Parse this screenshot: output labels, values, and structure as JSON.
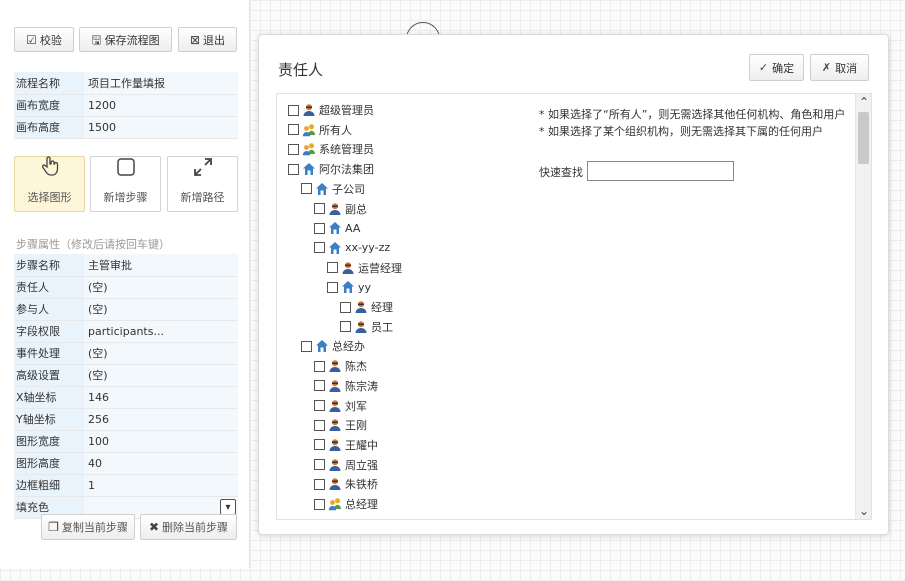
{
  "toolbar": {
    "validate_label": "校验",
    "save_flow_label": "保存流程图",
    "exit_label": "退出"
  },
  "flow_info": [
    {
      "key": "流程名称",
      "value": "项目工作量填报"
    },
    {
      "key": "画布宽度",
      "value": "1200"
    },
    {
      "key": "画布高度",
      "value": "1500"
    }
  ],
  "tools": [
    {
      "label": "选择图形",
      "icon": "pointer-hand-icon",
      "active": true
    },
    {
      "label": "新增步骤",
      "icon": "square-outline-icon",
      "active": false
    },
    {
      "label": "新增路径",
      "icon": "diagonal-arrows-icon",
      "active": false
    }
  ],
  "step_props_title": "步骤属性（修改后请按回车键）",
  "step_props": [
    {
      "key": "步骤名称",
      "value": "主管审批"
    },
    {
      "key": "责任人",
      "value": "(空)"
    },
    {
      "key": "参与人",
      "value": "(空)"
    },
    {
      "key": "字段权限",
      "value": "participants..."
    },
    {
      "key": "事件处理",
      "value": "(空)"
    },
    {
      "key": "高级设置",
      "value": "(空)"
    },
    {
      "key": "X轴坐标",
      "value": "146"
    },
    {
      "key": "Y轴坐标",
      "value": "256"
    },
    {
      "key": "图形宽度",
      "value": "100"
    },
    {
      "key": "图形高度",
      "value": "40"
    },
    {
      "key": "边框粗细",
      "value": "1"
    }
  ],
  "fill_color_label": "填充色",
  "fill_color_value": "",
  "actions": {
    "copy_step_label": "复制当前步骤",
    "delete_step_label": "删除当前步骤"
  },
  "modal": {
    "title": "责任人",
    "confirm_label": "确定",
    "cancel_label": "取消",
    "notes": [
      "* 如果选择了“所有人”，则无需选择其他任何机构、角色和用户",
      "* 如果选择了某个组织机构，则无需选择其下属的任何用户"
    ],
    "search_label": "快速查找",
    "search_value": "",
    "tree": [
      {
        "label": "超级管理员",
        "type": "user",
        "level": 0
      },
      {
        "label": "所有人",
        "type": "group",
        "level": 0
      },
      {
        "label": "系统管理员",
        "type": "group",
        "level": 0
      },
      {
        "label": "阿尔法集团",
        "type": "org",
        "level": 0
      },
      {
        "label": "子公司",
        "type": "org",
        "level": 1
      },
      {
        "label": "副总",
        "type": "user",
        "level": 2
      },
      {
        "label": "AA",
        "type": "org",
        "level": 2
      },
      {
        "label": "xx-yy-zz",
        "type": "org",
        "level": 2
      },
      {
        "label": "运营经理",
        "type": "user",
        "level": 3
      },
      {
        "label": "yy",
        "type": "org",
        "level": 3
      },
      {
        "label": "经理",
        "type": "user",
        "level": 4
      },
      {
        "label": "员工",
        "type": "user",
        "level": 4
      },
      {
        "label": "总经办",
        "type": "org",
        "level": 1
      },
      {
        "label": "陈杰",
        "type": "user",
        "level": 2
      },
      {
        "label": "陈宗涛",
        "type": "user",
        "level": 2
      },
      {
        "label": "刘军",
        "type": "user",
        "level": 2
      },
      {
        "label": "王刚",
        "type": "user",
        "level": 2
      },
      {
        "label": "王耀中",
        "type": "user",
        "level": 2
      },
      {
        "label": "周立强",
        "type": "user",
        "level": 2
      },
      {
        "label": "朱铁桥",
        "type": "user",
        "level": 2
      },
      {
        "label": "总经理",
        "type": "group",
        "level": 2
      }
    ]
  },
  "colors": {
    "key_cell_bg": "#e9f3fb",
    "active_tool_bg": "#fdf6d8",
    "user_icon": "#d9752b",
    "org_icon": "#3b7fc4"
  }
}
